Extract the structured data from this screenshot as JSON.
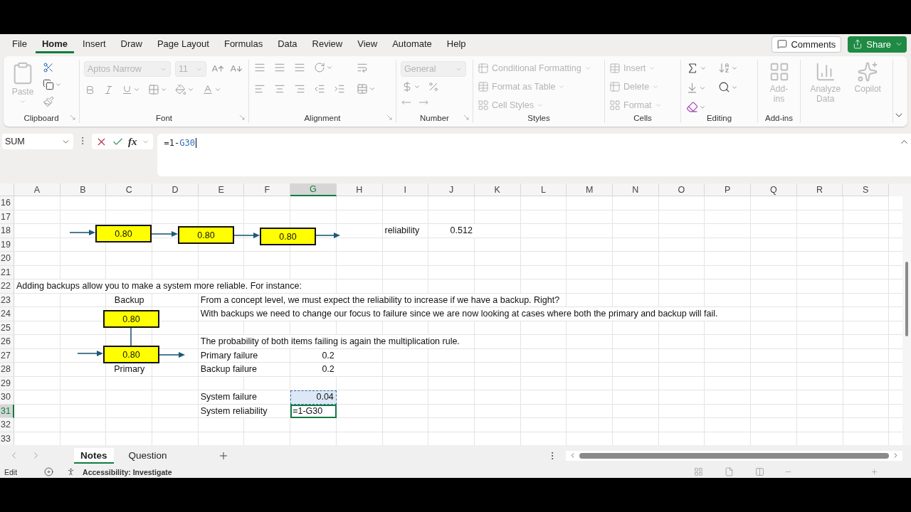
{
  "menu": {
    "tabs": [
      {
        "label": "File",
        "selected": false
      },
      {
        "label": "Home",
        "selected": true
      },
      {
        "label": "Insert",
        "selected": false
      },
      {
        "label": "Draw",
        "selected": false
      },
      {
        "label": "Page Layout",
        "selected": false
      },
      {
        "label": "Formulas",
        "selected": false
      },
      {
        "label": "Data",
        "selected": false
      },
      {
        "label": "Review",
        "selected": false
      },
      {
        "label": "View",
        "selected": false
      },
      {
        "label": "Automate",
        "selected": false
      },
      {
        "label": "Help",
        "selected": false
      }
    ],
    "comments_button": "Comments",
    "share_button": "Share"
  },
  "ribbon": {
    "groups": [
      {
        "kind": "clipboard",
        "label": "Clipboard",
        "buttons": [
          {
            "label": "Paste",
            "disabled": true
          }
        ]
      },
      {
        "kind": "font",
        "label": "Font",
        "font_name": "Aptos Narrow",
        "font_size": "11",
        "disabled": true
      },
      {
        "kind": "alignment",
        "label": "Alignment"
      },
      {
        "kind": "number",
        "label": "Number",
        "format": "General",
        "disabled": true
      },
      {
        "kind": "styles",
        "label": "Styles",
        "buttons": [
          {
            "label": "Conditional Formatting",
            "disabled": true
          },
          {
            "label": "Format as Table",
            "disabled": true
          },
          {
            "label": "Cell Styles",
            "disabled": true
          }
        ]
      },
      {
        "kind": "cells",
        "label": "Cells",
        "buttons": [
          {
            "label": "Insert",
            "disabled": true
          },
          {
            "label": "Delete",
            "disabled": true
          },
          {
            "label": "Format",
            "disabled": true
          }
        ]
      },
      {
        "kind": "editing",
        "label": "Editing"
      },
      {
        "kind": "addins",
        "label": "Add-ins",
        "buttons": [
          {
            "label": "Add-ins",
            "disabled": true
          }
        ]
      },
      {
        "kind": "ai",
        "buttons": [
          {
            "label": "Analyze Data",
            "disabled": true
          },
          {
            "label": "Copilot",
            "disabled": true
          }
        ]
      }
    ]
  },
  "formula_bar": {
    "name_box": "SUM",
    "function_label": "fx",
    "formula_prefix": "=1-",
    "formula_reference": "G30"
  },
  "sheet": {
    "columns": [
      {
        "label": "A",
        "selected": false
      },
      {
        "label": "B",
        "selected": false
      },
      {
        "label": "C",
        "selected": false
      },
      {
        "label": "D",
        "selected": false
      },
      {
        "label": "E",
        "selected": false
      },
      {
        "label": "F",
        "selected": false
      },
      {
        "label": "G",
        "selected": true
      },
      {
        "label": "H",
        "selected": false
      },
      {
        "label": "I",
        "selected": false
      },
      {
        "label": "J",
        "selected": false
      },
      {
        "label": "K",
        "selected": false
      },
      {
        "label": "L",
        "selected": false
      },
      {
        "label": "M",
        "selected": false
      },
      {
        "label": "N",
        "selected": false
      },
      {
        "label": "O",
        "selected": false
      },
      {
        "label": "P",
        "selected": false
      },
      {
        "label": "Q",
        "selected": false
      },
      {
        "label": "R",
        "selected": false
      },
      {
        "label": "S",
        "selected": false
      }
    ],
    "rows": [
      {
        "number": "16",
        "selected": false
      },
      {
        "number": "17",
        "selected": false
      },
      {
        "number": "18",
        "selected": false,
        "cells": {
          "I": {
            "text": "reliability",
            "kind": "text"
          },
          "J": {
            "text": "0.512",
            "kind": "number"
          }
        }
      },
      {
        "number": "19",
        "selected": false
      },
      {
        "number": "20",
        "selected": false
      },
      {
        "number": "21",
        "selected": false
      },
      {
        "number": "22",
        "selected": false,
        "cells": {
          "A": {
            "text": "Adding backups allow you to make a system more reliable. For instance:",
            "kind": "text"
          }
        }
      },
      {
        "number": "23",
        "selected": false,
        "cells": {
          "C": {
            "text": "Backup",
            "kind": "centered"
          },
          "E": {
            "text": "From a concept level, we must expect the reliability to increase if we have a backup. Right?",
            "kind": "text"
          }
        }
      },
      {
        "number": "24",
        "selected": false,
        "cells": {
          "E": {
            "text": "With backups we need to change our focus to failure since we are now looking at cases where both the primary and backup will fail.",
            "kind": "text"
          }
        }
      },
      {
        "number": "25",
        "selected": false
      },
      {
        "number": "26",
        "selected": false,
        "cells": {
          "E": {
            "text": "The probability of both items failing is again the multiplication rule.",
            "kind": "text"
          }
        }
      },
      {
        "number": "27",
        "selected": false,
        "cells": {
          "E": {
            "text": "Primary failure",
            "kind": "text"
          },
          "G": {
            "text": "0.2",
            "kind": "number"
          }
        }
      },
      {
        "number": "28",
        "selected": false,
        "cells": {
          "C": {
            "text": "Primary",
            "kind": "centered"
          },
          "E": {
            "text": "Backup failure",
            "kind": "text"
          },
          "G": {
            "text": "0.2",
            "kind": "number"
          }
        }
      },
      {
        "number": "29",
        "selected": false
      },
      {
        "number": "30",
        "selected": false,
        "cells": {
          "E": {
            "text": "System failure",
            "kind": "text"
          },
          "G": {
            "text": "0.04",
            "kind": "number",
            "referenced": true,
            "selected": false
          }
        }
      },
      {
        "number": "31",
        "selected": true,
        "cells": {
          "E": {
            "text": "System reliability",
            "kind": "text"
          },
          "G": {
            "text": "=1-G30",
            "kind": "text",
            "referenced": false,
            "selected": true
          }
        }
      },
      {
        "number": "32",
        "selected": false
      },
      {
        "number": "33",
        "selected": false
      }
    ],
    "diagram": {
      "series_boxes": [
        {
          "value": "0.80"
        },
        {
          "value": "0.80"
        },
        {
          "value": "0.80"
        }
      ],
      "backup_box": {
        "value": "0.80"
      },
      "primary_box": {
        "value": "0.80"
      }
    }
  },
  "sheet_tabs": [
    {
      "label": "Notes",
      "selected": true
    },
    {
      "label": "Question",
      "selected": false
    }
  ],
  "status_bar": {
    "mode": "Edit",
    "accessibility": "Accessibility: Investigate"
  }
}
